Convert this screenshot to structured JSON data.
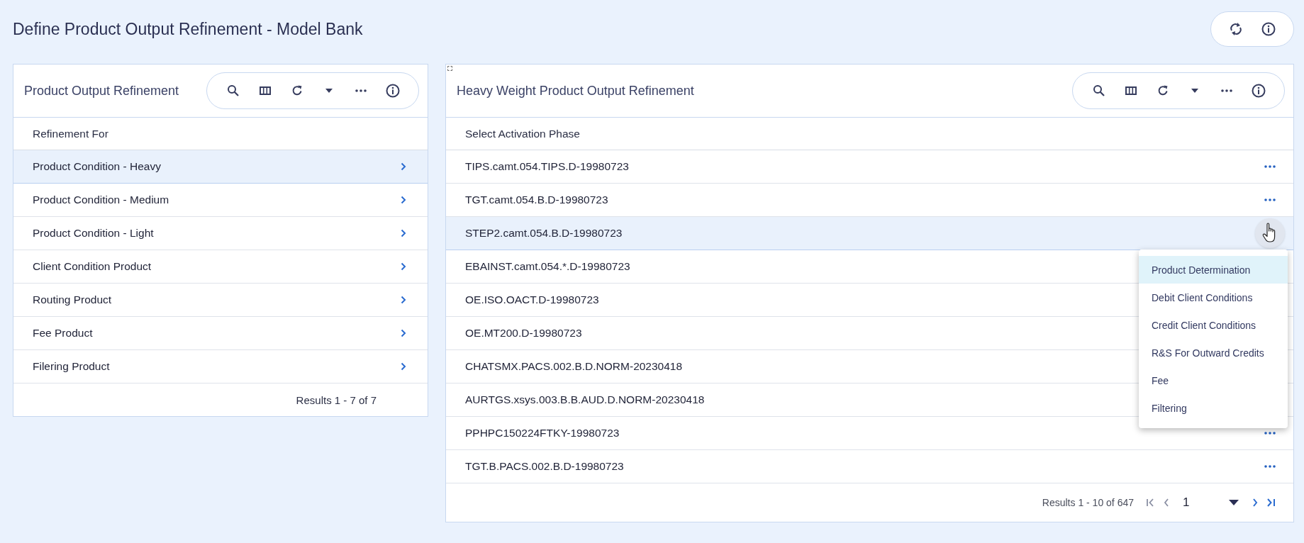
{
  "page": {
    "title": "Define Product Output Refinement - Model Bank"
  },
  "left_panel": {
    "title": "Product Output Refinement",
    "column": "Refinement For",
    "items": [
      {
        "label": "Product Condition - Heavy",
        "selected": true
      },
      {
        "label": "Product Condition - Medium",
        "selected": false
      },
      {
        "label": "Product Condition - Light",
        "selected": false
      },
      {
        "label": "Client Condition Product",
        "selected": false
      },
      {
        "label": "Routing Product",
        "selected": false
      },
      {
        "label": "Fee Product",
        "selected": false
      },
      {
        "label": "Filering Product",
        "selected": false
      }
    ],
    "results": "Results 1 - 7 of 7"
  },
  "right_panel": {
    "title": "Heavy Weight Product Output Refinement",
    "column": "Select Activation Phase",
    "rows": [
      {
        "label": "TIPS.camt.054.TIPS.D-19980723",
        "selected": false
      },
      {
        "label": "TGT.camt.054.B.D-19980723",
        "selected": false
      },
      {
        "label": "STEP2.camt.054.B.D-19980723",
        "selected": true
      },
      {
        "label": "EBAINST.camt.054.*.D-19980723",
        "selected": false
      },
      {
        "label": "OE.ISO.OACT.D-19980723",
        "selected": false
      },
      {
        "label": "OE.MT200.D-19980723",
        "selected": false
      },
      {
        "label": "CHATSMX.PACS.002.B.D.NORM-20230418",
        "selected": false
      },
      {
        "label": "AURTGS.xsys.003.B.B.AUD.D.NORM-20230418",
        "selected": false
      },
      {
        "label": "PPHPC150224FTKY-19980723",
        "selected": false
      },
      {
        "label": "TGT.B.PACS.002.B.D-19980723",
        "selected": false
      }
    ],
    "context_menu": [
      {
        "label": "Product Determination",
        "selected": true
      },
      {
        "label": "Debit Client Conditions",
        "selected": false
      },
      {
        "label": "Credit Client Conditions",
        "selected": false
      },
      {
        "label": "R&S For Outward Credits",
        "selected": false
      },
      {
        "label": "Fee",
        "selected": false
      },
      {
        "label": "Filtering",
        "selected": false
      }
    ],
    "results": "Results 1 - 10 of 647",
    "page": "1"
  }
}
